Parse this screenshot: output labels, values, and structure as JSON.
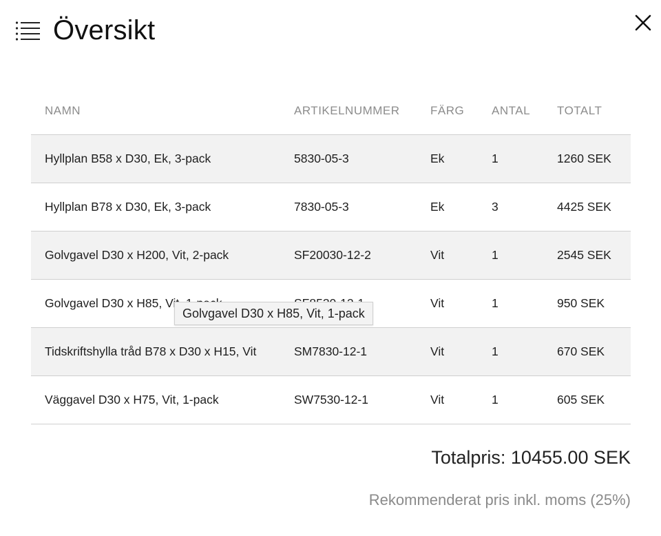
{
  "header": {
    "title": "Översikt",
    "menu_icon": "hamburger-list-icon",
    "close_icon": "close-icon"
  },
  "table": {
    "columns": [
      "NAMN",
      "ARTIKELNUMMER",
      "FÄRG",
      "ANTAL",
      "TOTALT"
    ],
    "rows": [
      {
        "name": "Hyllplan B58 x D30, Ek, 3-pack",
        "article": "5830-05-3",
        "color": "Ek",
        "qty": "1",
        "total": "1260 SEK"
      },
      {
        "name": "Hyllplan B78 x D30, Ek, 3-pack",
        "article": "7830-05-3",
        "color": "Ek",
        "qty": "3",
        "total": "4425 SEK"
      },
      {
        "name": "Golvgavel D30 x H200, Vit, 2-pack",
        "article": "SF20030-12-2",
        "color": "Vit",
        "qty": "1",
        "total": "2545 SEK"
      },
      {
        "name": "Golvgavel D30 x H85, Vit, 1-pack",
        "article": "SF8530-12-1",
        "color": "Vit",
        "qty": "1",
        "total": "950 SEK"
      },
      {
        "name": "Tidskriftshylla tråd B78 x D30 x H15, Vit",
        "article": "SM7830-12-1",
        "color": "Vit",
        "qty": "1",
        "total": "670 SEK"
      },
      {
        "name": "Väggavel D30 x H75, Vit, 1-pack",
        "article": "SW7530-12-1",
        "color": "Vit",
        "qty": "1",
        "total": "605 SEK"
      }
    ]
  },
  "tooltip": {
    "text": "Golvgavel D30 x H85, Vit, 1-pack"
  },
  "summary": {
    "total_label": "Totalpris: 10455.00 SEK",
    "vat_note": "Rekommenderat pris inkl. moms (25%)"
  },
  "colors": {
    "row_shade": "#f2f2f2",
    "header_text": "#8c8c8c",
    "divider": "#cfcfcf"
  }
}
